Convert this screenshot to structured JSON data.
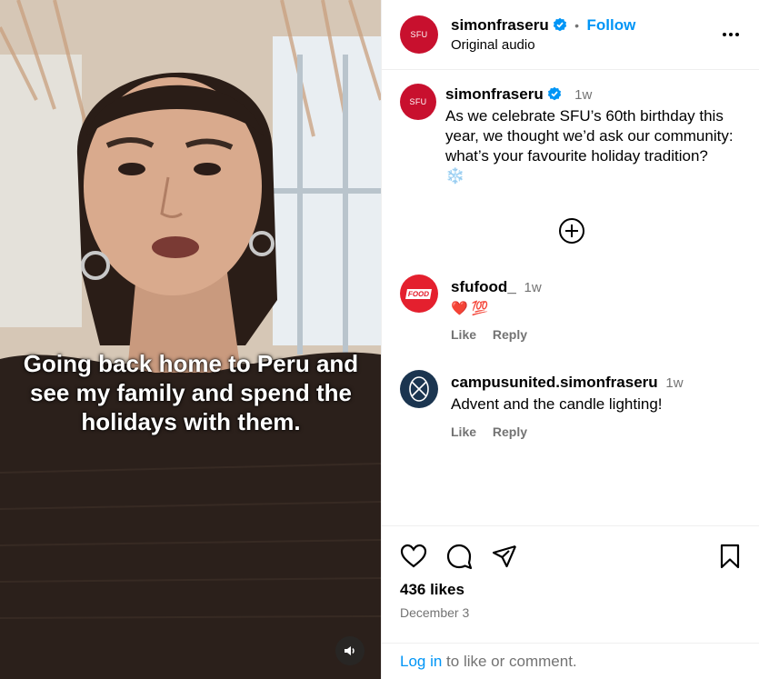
{
  "video": {
    "caption": "Going back home to Peru and see my family and spend the holidays with them.",
    "icons": {
      "mute": "speaker-icon"
    }
  },
  "header": {
    "avatar_text": "SFU",
    "username": "simonfraseru",
    "separator": "•",
    "follow_label": "Follow",
    "audio_label": "Original audio",
    "more_icon": "more-options-icon"
  },
  "post": {
    "avatar_text": "SFU",
    "username": "simonfraseru",
    "time": "1w",
    "text": "As we celebrate SFU’s 60th birthday this year, we thought we’d ask our community: what’s your favourite holiday tradition?",
    "emoji": "❄️",
    "add_icon": "plus-circle-icon"
  },
  "comments": [
    {
      "username": "sfufood_",
      "time": "1w",
      "text": "❤️ 💯",
      "avatar_text": "FOOD",
      "like_label": "Like",
      "reply_label": "Reply"
    },
    {
      "username": "campusunited.simonfraseru",
      "time": "1w",
      "text": "Advent and the candle lighting!",
      "like_label": "Like",
      "reply_label": "Reply"
    }
  ],
  "actions": {
    "likes": "436 likes",
    "date": "December 3",
    "login_link": "Log in",
    "login_rest": " to like or comment.",
    "icons": [
      "heart-icon",
      "comment-icon",
      "share-icon",
      "bookmark-icon"
    ]
  },
  "colors": {
    "brand_red": "#c8102e",
    "link_blue": "#0095f6",
    "verified_blue": "#0095f6",
    "muted": "#737373",
    "campus_navy": "#1b3550"
  }
}
